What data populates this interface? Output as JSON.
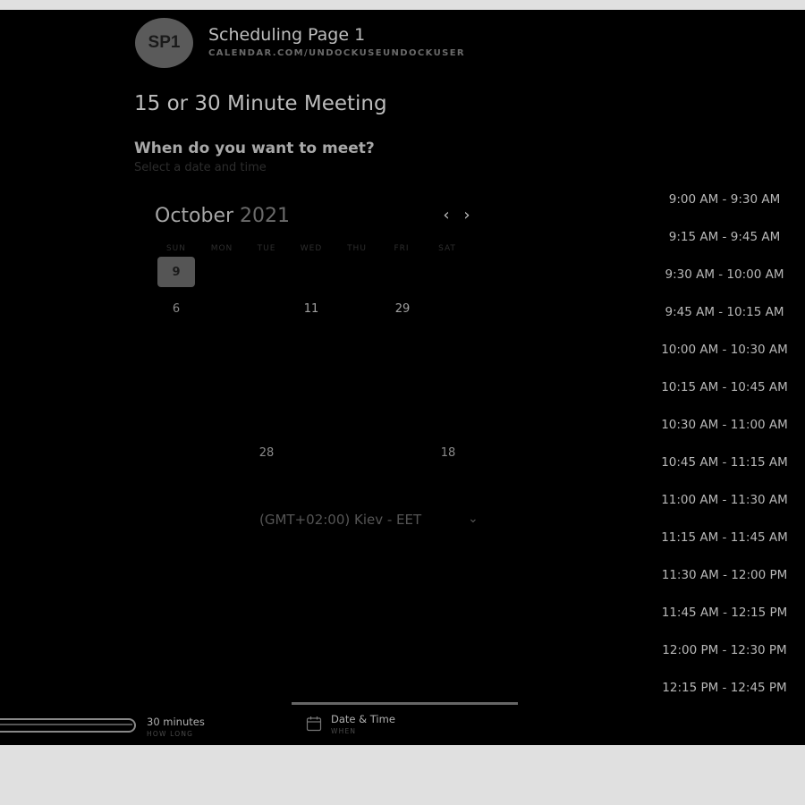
{
  "header": {
    "avatar_initials": "SP1",
    "page_name": "Scheduling Page 1",
    "page_url": "CALENDAR.COM/UNDOCKUSEUNDOCKUSER"
  },
  "event": {
    "title": "15 or 30 Minute Meeting",
    "prompt": "When do you want to meet?",
    "subprompt": "Select a date and time"
  },
  "calendar": {
    "month": "October",
    "year": "2021",
    "weekdays": [
      "SUN",
      "MON",
      "TUE",
      "WED",
      "THU",
      "FRI",
      "SAT"
    ],
    "selected_day": "9",
    "visible_days": [
      "6",
      "11",
      "29",
      "28",
      "18"
    ]
  },
  "timezone": {
    "label": "(GMT+02:00) Kiev - EET"
  },
  "time_slots": [
    "9:00 AM - 9:30 AM",
    "9:15 AM - 9:45 AM",
    "9:30 AM - 10:00 AM",
    "9:45 AM - 10:15 AM",
    "10:00 AM - 10:30 AM",
    "10:15 AM - 10:45 AM",
    "10:30 AM - 11:00 AM",
    "10:45 AM - 11:15 AM",
    "11:00 AM - 11:30 AM",
    "11:15 AM - 11:45 AM",
    "11:30 AM - 12:00 PM",
    "11:45 AM - 12:15 PM",
    "12:00 PM - 12:30 PM",
    "12:15 PM - 12:45 PM"
  ],
  "steps": {
    "duration": {
      "label": "30 minutes",
      "sub": "HOW LONG"
    },
    "datetime": {
      "label": "Date & Time",
      "sub": "WHEN"
    }
  },
  "icons": {
    "prev": "chevron-left-icon",
    "next": "chevron-right-icon",
    "timezone_toggle": "chevron-down-icon",
    "datetime_step": "calendar-icon"
  }
}
